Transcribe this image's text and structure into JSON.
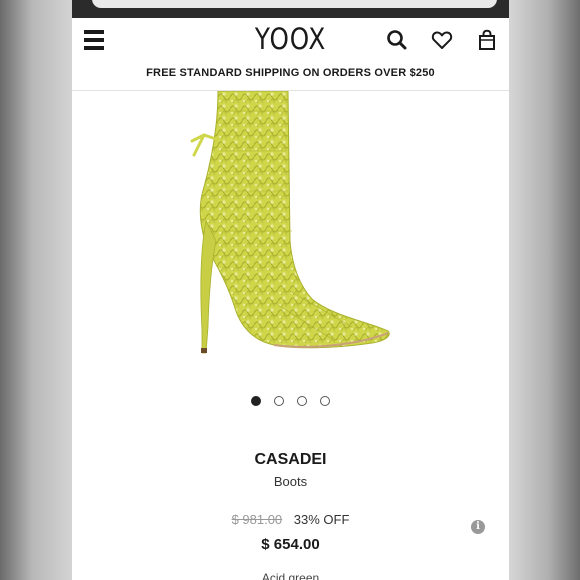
{
  "header": {
    "logo": "YOOX",
    "shipping_banner": "FREE STANDARD SHIPPING ON ORDERS OVER $250",
    "icons": [
      "menu-icon",
      "search-icon",
      "heart-icon",
      "bag-icon"
    ]
  },
  "gallery": {
    "image_description": "yellow-green crochet knit pointed stiletto boot",
    "dots_total": 4,
    "active_dot": 1
  },
  "product": {
    "brand": "CASADEI",
    "category": "Boots",
    "old_price": "$ 981.00",
    "discount": "33% OFF",
    "price": "$ 654.00",
    "color": "Acid green"
  },
  "colors": {
    "boot": "#cfd64a",
    "boot_shadow": "#a9b02c",
    "text": "#1a1a1a"
  }
}
